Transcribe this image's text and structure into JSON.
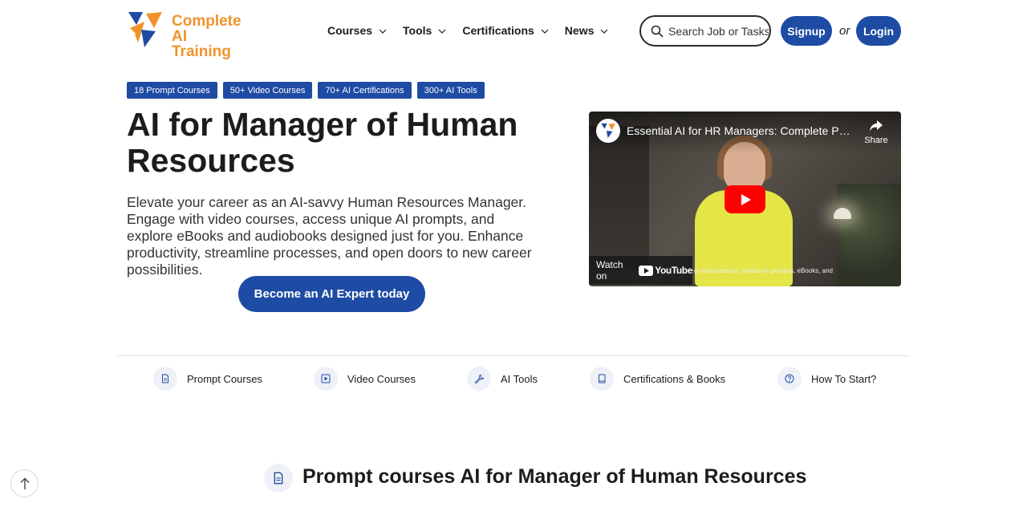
{
  "brand": {
    "line1": "Complete",
    "line2": "AI Training",
    "accent": "#f0922b",
    "primary": "#1e4ba3"
  },
  "nav": {
    "items": [
      {
        "label": "Courses",
        "icon": "chevron-down-icon"
      },
      {
        "label": "Tools",
        "icon": "chevron-down-icon"
      },
      {
        "label": "Certifications",
        "icon": "chevron-down-icon"
      },
      {
        "label": "News",
        "icon": "chevron-down-icon"
      }
    ]
  },
  "search": {
    "placeholder": "Search Job or Tasks",
    "icon": "search-icon"
  },
  "auth": {
    "signup": "Signup",
    "or": "or",
    "login": "Login"
  },
  "tags": [
    "18 Prompt Courses",
    "50+ Video Courses",
    "70+ AI Certifications",
    "300+ AI Tools"
  ],
  "hero": {
    "title": "AI for Manager of Human Resources",
    "description": "Elevate your career as an AI-savvy Human Resources Manager. Engage with video courses, access unique AI prompts, and explore eBooks and audiobooks designed just for you. Enhance productivity, streamline processes, and open doors to new career possibilities.",
    "cta": "Become an AI Expert today"
  },
  "video": {
    "title": "Essential AI for HR Managers: Complete Pro...",
    "share": "Share",
    "watch_on": "Watch on",
    "platform": "YouTube",
    "caption": "g video lessons, hands-on prompts, eBooks, and"
  },
  "features": [
    {
      "label": "Prompt Courses",
      "icon": "document-icon"
    },
    {
      "label": "Video Courses",
      "icon": "play-square-icon"
    },
    {
      "label": "AI Tools",
      "icon": "wrench-icon"
    },
    {
      "label": "Certifications & Books",
      "icon": "book-icon"
    },
    {
      "label": "How To Start?",
      "icon": "question-circle-icon"
    }
  ],
  "section": {
    "title": "Prompt courses AI for Manager of Human Resources",
    "icon": "document-icon"
  },
  "scroll_top": {
    "icon": "arrow-up-icon"
  }
}
